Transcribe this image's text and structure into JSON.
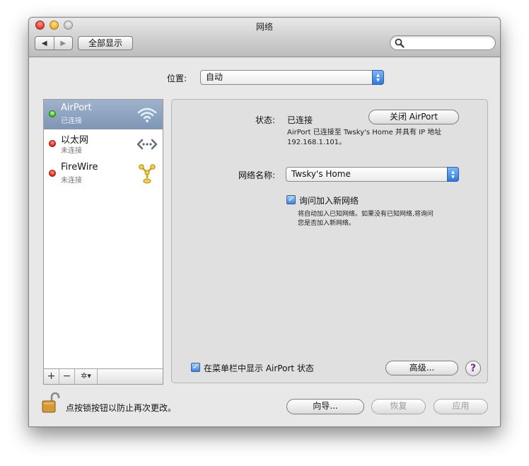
{
  "window": {
    "title": "网络",
    "back_icon": "◀",
    "forward_icon": "▶",
    "show_all_label": "全部显示",
    "search_placeholder": ""
  },
  "location": {
    "label": "位置:",
    "value": "自动"
  },
  "services": [
    {
      "name": "AirPort",
      "status": "已连接",
      "status_color": "#3cba1b",
      "icon": "wifi-icon",
      "selected": true
    },
    {
      "name": "以太网",
      "status": "未连接",
      "status_color": "#dd2a1e",
      "icon": "ethernet-icon",
      "selected": false
    },
    {
      "name": "FireWire",
      "status": "未连接",
      "status_color": "#dd2a1e",
      "icon": "firewire-icon",
      "selected": false
    }
  ],
  "list_controls": {
    "add_label": "+",
    "remove_label": "−",
    "action_label": "✲▾"
  },
  "detail": {
    "status_label": "状态:",
    "status_value": "已连接",
    "turn_off_label": "关闭 AirPort",
    "description_line1": "AirPort 已连接至 Twsky's Home 并具有 IP 地址",
    "description_line2": "192.168.1.101。",
    "network_name_label": "网络名称:",
    "network_name_value": "Twsky's Home",
    "ask_join_label": "询问加入新网络",
    "ask_join_checked": true,
    "ask_join_help_line1": "将自动加入已知网络。如果没有已知网络,将询问",
    "ask_join_help_line2": "您是否加入新网络。",
    "show_menubar_label": "在菜单栏中显示 AirPort 状态",
    "show_menubar_checked": true,
    "advanced_label": "高级...",
    "help_label": "?"
  },
  "footer": {
    "lock_text": "点按锁按钮以防止再次更改。",
    "assistant_label": "向导...",
    "revert_label": "恢复",
    "apply_label": "应用"
  },
  "colors": {
    "selection": "#8ea3bf",
    "accent_blue": "#2f78d8",
    "help_purple": "#7a2b8f"
  }
}
